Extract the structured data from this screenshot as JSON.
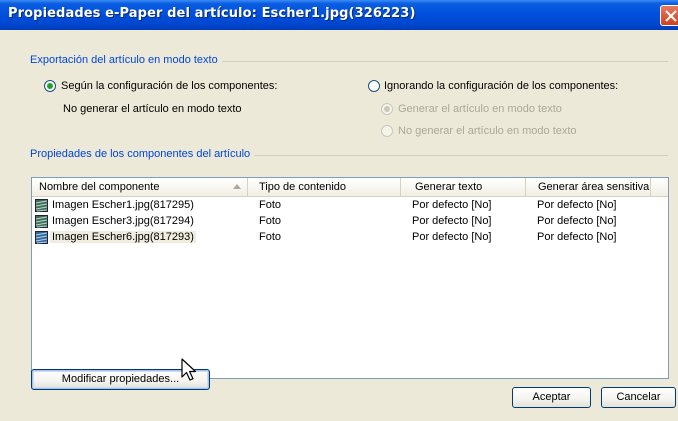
{
  "window": {
    "title": "Propiedades e-Paper del artículo: Escher1.jpg(326223)"
  },
  "export_group": {
    "title": "Exportación del artículo en modo texto",
    "option_components": {
      "label": "Según la configuración de los componentes:",
      "checked": true,
      "sub_text": "No generar el artículo en modo texto"
    },
    "option_ignore": {
      "label": "Ignorando la configuración de los componentes:",
      "checked": false,
      "sub_options": [
        {
          "label": "Generar el artículo en modo texto",
          "checked": true,
          "enabled": false
        },
        {
          "label": "No generar el artículo en modo texto",
          "checked": false,
          "enabled": false
        }
      ]
    }
  },
  "properties_group": {
    "title": "Propiedades de los componentes del artículo"
  },
  "table": {
    "columns": [
      "Nombre del componente",
      "Tipo de contenido",
      "Generar texto",
      "Generar área sensitiva"
    ],
    "sorted_column": "Nombre del componente",
    "rows": [
      {
        "name": "Imagen Escher1.jpg(817295)",
        "type": "Foto",
        "text": "Por defecto [No]",
        "area": "Por defecto [No]",
        "selected": false
      },
      {
        "name": "Imagen Escher3.jpg(817294)",
        "type": "Foto",
        "text": "Por defecto [No]",
        "area": "Por defecto [No]",
        "selected": false
      },
      {
        "name": "Imagen Escher6.jpg(817293)",
        "type": "Foto",
        "text": "Por defecto [No]",
        "area": "Por defecto [No]",
        "selected": true
      }
    ]
  },
  "buttons": {
    "modify": "Modificar propiedades...",
    "accept": "Aceptar",
    "cancel": "Cancelar"
  },
  "colors": {
    "titlebar": "#0050dd",
    "group_title": "#0046d5",
    "dialog_bg": "#ece9d8",
    "radio_dot": "#21a121"
  },
  "icons": {
    "row_icon": "image-component-icon",
    "close": "close-icon",
    "cursor": "mouse-pointer-icon"
  }
}
